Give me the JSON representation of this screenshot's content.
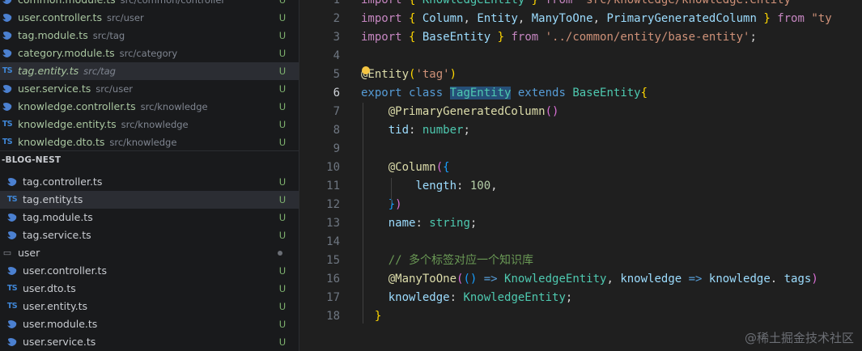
{
  "open_editors": [
    {
      "icon": "nest",
      "name": "common.module.ts",
      "path": "src/common/controller",
      "badge": "U"
    },
    {
      "icon": "nest",
      "name": "user.controller.ts",
      "path": "src/user",
      "badge": "U"
    },
    {
      "icon": "nest",
      "name": "tag.module.ts",
      "path": "src/tag",
      "badge": "U"
    },
    {
      "icon": "nest",
      "name": "category.module.ts",
      "path": "src/category",
      "badge": "U"
    },
    {
      "icon": "TS",
      "name": "tag.entity.ts",
      "path": "src/tag",
      "badge": "U",
      "selected": true
    },
    {
      "icon": "nest",
      "name": "user.service.ts",
      "path": "src/user",
      "badge": "U"
    },
    {
      "icon": "nest",
      "name": "knowledge.controller.ts",
      "path": "src/knowledge",
      "badge": "U"
    },
    {
      "icon": "TS",
      "name": "knowledge.entity.ts",
      "path": "src/knowledge",
      "badge": "U"
    },
    {
      "icon": "TS",
      "name": "knowledge.dto.ts",
      "path": "src/knowledge",
      "badge": "U"
    }
  ],
  "explorer": {
    "section_title": "-BLOG-NEST",
    "items": [
      {
        "icon": "nest",
        "name": "tag.controller.ts",
        "badge": "U",
        "indent": 1
      },
      {
        "icon": "TS",
        "name": "tag.entity.ts",
        "badge": "U",
        "indent": 1,
        "selected": true
      },
      {
        "icon": "nest",
        "name": "tag.module.ts",
        "badge": "U",
        "indent": 1
      },
      {
        "icon": "nest",
        "name": "tag.service.ts",
        "badge": "U",
        "indent": 1
      },
      {
        "icon": "folder",
        "name": "user",
        "badge": "",
        "indent": 0,
        "dot": true
      },
      {
        "icon": "nest",
        "name": "user.controller.ts",
        "badge": "U",
        "indent": 1
      },
      {
        "icon": "TS",
        "name": "user.dto.ts",
        "badge": "U",
        "indent": 1
      },
      {
        "icon": "TS",
        "name": "user.entity.ts",
        "badge": "U",
        "indent": 1
      },
      {
        "icon": "nest",
        "name": "user.module.ts",
        "badge": "U",
        "indent": 1
      },
      {
        "icon": "nest",
        "name": "user.service.ts",
        "badge": "U",
        "indent": 1
      }
    ]
  },
  "editor": {
    "line_numbers": [
      "1",
      "2",
      "3",
      "4",
      "5",
      "6",
      "7",
      "8",
      "9",
      "10",
      "11",
      "12",
      "13",
      "14",
      "15",
      "16",
      "17",
      "18"
    ],
    "active_line": "6",
    "lines": [
      [
        [
          "kw2",
          "import "
        ],
        [
          "br1",
          "{ "
        ],
        [
          "cls",
          "KnowledgeEntity"
        ],
        [
          "br1",
          " }"
        ],
        [
          "kw2",
          " from "
        ],
        [
          "str",
          "'src/knowledge/knowledge.entity'"
        ],
        [
          "",
          "'"
        ]
      ],
      [
        [
          "kw2",
          "import "
        ],
        [
          "br1",
          "{ "
        ],
        [
          "var",
          "Column"
        ],
        [
          "",
          ", "
        ],
        [
          "var",
          "Entity"
        ],
        [
          "",
          ", "
        ],
        [
          "var",
          "ManyToOne"
        ],
        [
          "",
          ", "
        ],
        [
          "var",
          "PrimaryGeneratedColumn"
        ],
        [
          "br1",
          " }"
        ],
        [
          "kw2",
          " from "
        ],
        [
          "str",
          "\"ty"
        ]
      ],
      [
        [
          "kw2",
          "import "
        ],
        [
          "br1",
          "{ "
        ],
        [
          "var",
          "BaseEntity"
        ],
        [
          "br1",
          " }"
        ],
        [
          "kw2",
          " from "
        ],
        [
          "str",
          "'../common/entity/base-entity'"
        ],
        [
          "",
          ";"
        ]
      ],
      [],
      [
        [
          "fn",
          "@Entity"
        ],
        [
          "br1",
          "("
        ],
        [
          "str",
          "'tag'"
        ],
        [
          "br1",
          ")"
        ]
      ],
      [
        [
          "kw",
          "export "
        ],
        [
          "kw",
          "class "
        ],
        [
          "cls hl",
          "TagEntity"
        ],
        [
          "kw",
          " extends "
        ],
        [
          "cls",
          "BaseEntity"
        ],
        [
          "br1",
          "{"
        ]
      ],
      [
        [
          "",
          "    "
        ],
        [
          "fn",
          "@PrimaryGeneratedColumn"
        ],
        [
          "br2",
          "()"
        ]
      ],
      [
        [
          "",
          "    "
        ],
        [
          "var",
          "tid"
        ],
        [
          "",
          ": "
        ],
        [
          "cls",
          "number"
        ],
        [
          "",
          ";"
        ]
      ],
      [],
      [
        [
          "",
          "    "
        ],
        [
          "fn",
          "@Column"
        ],
        [
          "br2",
          "("
        ],
        [
          "br3",
          "{"
        ]
      ],
      [
        [
          "",
          "        "
        ],
        [
          "var",
          "length"
        ],
        [
          "",
          ": "
        ],
        [
          "num",
          "100"
        ],
        [
          "",
          ","
        ]
      ],
      [
        [
          "",
          "    "
        ],
        [
          "br3",
          "}"
        ],
        [
          "br2",
          ")"
        ]
      ],
      [
        [
          "",
          "    "
        ],
        [
          "var",
          "name"
        ],
        [
          "",
          ": "
        ],
        [
          "cls",
          "string"
        ],
        [
          "",
          ";"
        ]
      ],
      [],
      [
        [
          "",
          "    "
        ],
        [
          "cmt",
          "// 多个标签对应一个知识库"
        ]
      ],
      [
        [
          "",
          "    "
        ],
        [
          "fn",
          "@ManyToOne"
        ],
        [
          "br2",
          "("
        ],
        [
          "br3",
          "()"
        ],
        [
          "kw",
          " => "
        ],
        [
          "cls",
          "KnowledgeEntity"
        ],
        [
          "",
          ", "
        ],
        [
          "var",
          "knowledge"
        ],
        [
          "kw",
          " => "
        ],
        [
          "var",
          "knowledge"
        ],
        [
          "",
          ". "
        ],
        [
          "var",
          "tags"
        ],
        [
          "br2",
          ")"
        ]
      ],
      [
        [
          "",
          "    "
        ],
        [
          "var",
          "knowledge"
        ],
        [
          "",
          ": "
        ],
        [
          "cls",
          "KnowledgeEntity"
        ],
        [
          "",
          ";"
        ]
      ],
      [
        [
          "",
          "  "
        ],
        [
          "br1",
          "}"
        ]
      ]
    ]
  },
  "watermark": "@稀土掘金技术社区"
}
